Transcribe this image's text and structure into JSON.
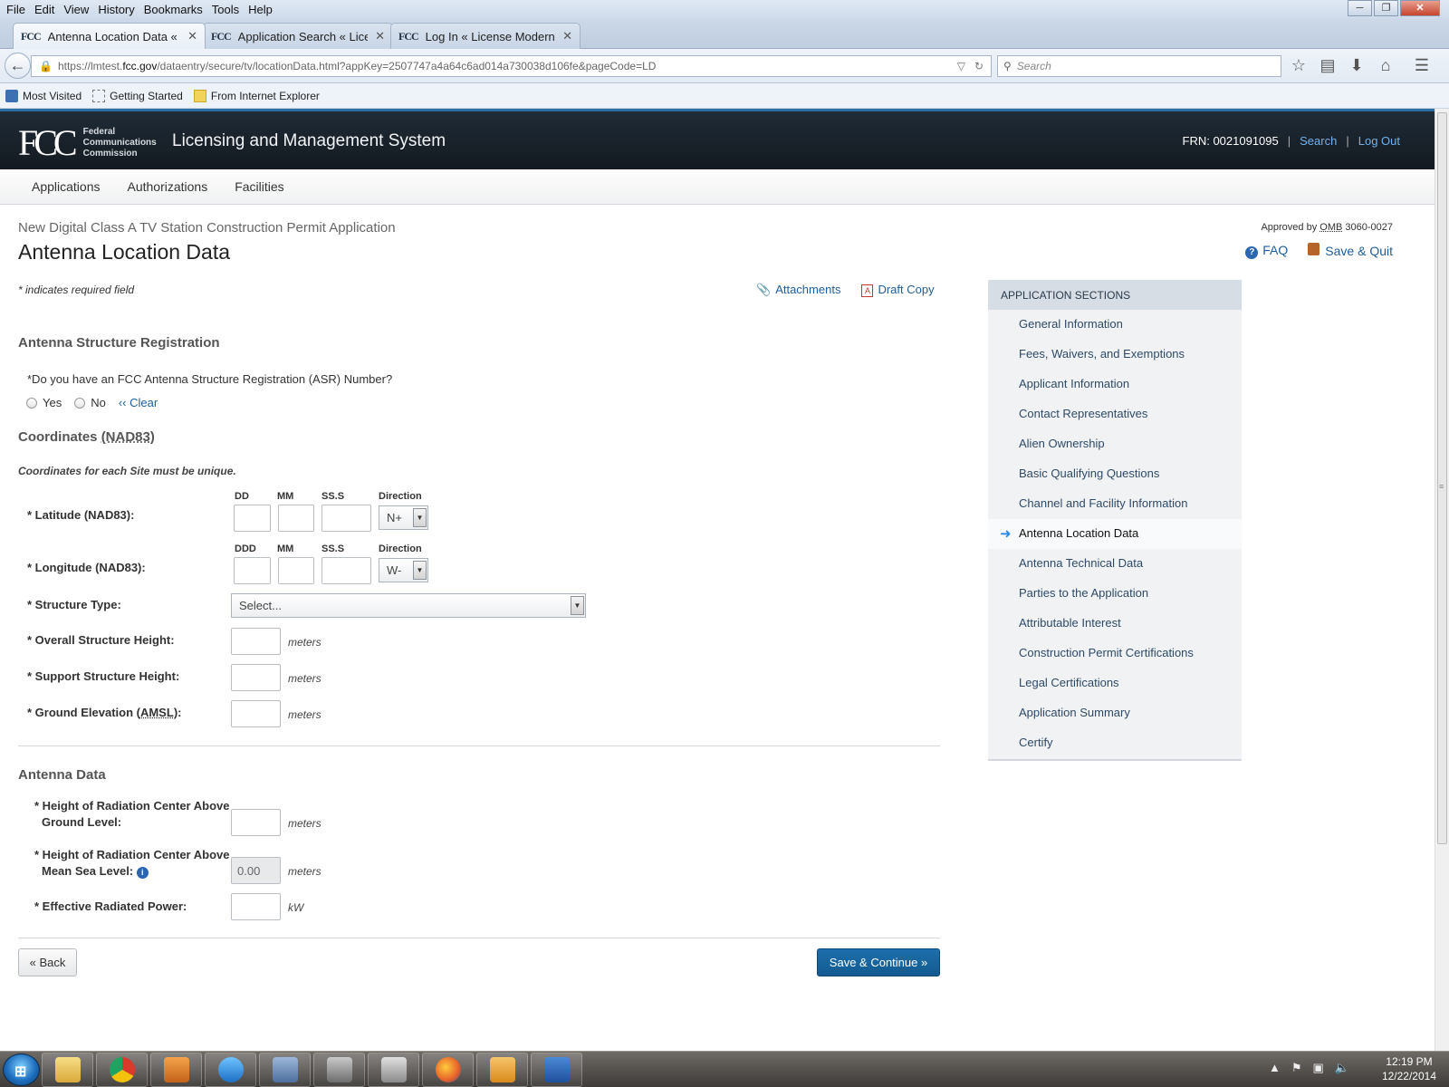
{
  "browser": {
    "menu": [
      "File",
      "Edit",
      "View",
      "History",
      "Bookmarks",
      "Tools",
      "Help"
    ],
    "tabs": [
      {
        "favicon": "FCC",
        "title": "Antenna Location Data « Li...",
        "active": true
      },
      {
        "favicon": "FCC",
        "title": "Application Search « Licen...",
        "active": false
      },
      {
        "favicon": "FCC",
        "title": "Log In « License Moderniza...",
        "active": false
      }
    ],
    "url_prefix": "https://lmtest.",
    "url_domain": "fcc.gov",
    "url_suffix": "/dataentry/secure/tv/locationData.html?appKey=2507747a4a64c6ad014a730038d106fe&pageCode=LD",
    "search_placeholder": "Search",
    "bookmarks": [
      "Most Visited",
      "Getting Started",
      "From Internet Explorer"
    ]
  },
  "header": {
    "org_line1": "Federal",
    "org_line2": "Communications",
    "org_line3": "Commission",
    "system_title": "Licensing and Management System",
    "frn": "FRN: 0021091095",
    "search_link": "Search",
    "logout_link": "Log Out"
  },
  "nav": [
    "Applications",
    "Authorizations",
    "Facilities"
  ],
  "page": {
    "breadcrumb": "New Digital Class A TV Station Construction Permit Application",
    "title": "Antenna Location Data",
    "approved": "Approved by",
    "omb": "OMB",
    "omb_number": "3060-0027",
    "faq": "FAQ",
    "save_quit": "Save & Quit",
    "required_note": "* indicates required field",
    "attachments": "Attachments",
    "draft_copy": "Draft Copy"
  },
  "asr": {
    "heading": "Antenna Structure Registration",
    "question": "*Do you have an FCC Antenna Structure Registration (ASR) Number?",
    "yes": "Yes",
    "no": "No",
    "clear": "‹‹ Clear"
  },
  "coords": {
    "heading": "Coordinates",
    "heading_abbr": "(NAD83)",
    "note": "Coordinates for each Site must be unique.",
    "lat_label": "* Latitude (NAD83):",
    "lon_label": "* Longitude (NAD83):",
    "lat_cols": [
      "DD",
      "MM",
      "SS.S",
      "Direction"
    ],
    "lon_cols": [
      "DDD",
      "MM",
      "SS.S",
      "Direction"
    ],
    "lat_dir": "N+",
    "lon_dir": "W-",
    "structure_type_label": "* Structure Type:",
    "structure_type_value": "Select...",
    "overall_height_label": "* Overall Structure Height:",
    "support_height_label": "* Support Structure Height:",
    "ground_elev_label_a": "* Ground Elevation (",
    "ground_elev_abbr": "AMSL",
    "ground_elev_label_b": "):",
    "unit_meters": "meters"
  },
  "antenna": {
    "heading": "Antenna Data",
    "rcagl_label_1": "* Height of Radiation Center Above",
    "rcagl_label_2": "Ground Level:",
    "rcamsl_label_1": "* Height of Radiation Center Above",
    "rcamsl_label_2": "Mean Sea Level:",
    "rcamsl_value": "0.00",
    "erp_label": "* Effective Radiated Power:",
    "unit_meters": "meters",
    "unit_kw": "kW"
  },
  "buttons": {
    "back": "« Back",
    "save_continue": "Save & Continue »"
  },
  "sidebar": {
    "heading": "APPLICATION SECTIONS",
    "items": [
      "General Information",
      "Fees, Waivers, and Exemptions",
      "Applicant Information",
      "Contact Representatives",
      "Alien Ownership",
      "Basic Qualifying Questions",
      "Channel and Facility Information",
      "Antenna Location Data",
      "Antenna Technical Data",
      "Parties to the Application",
      "Attributable Interest",
      "Construction Permit Certifications",
      "Legal Certifications",
      "Application Summary",
      "Certify"
    ],
    "current_index": 7
  },
  "taskbar": {
    "time": "12:19 PM",
    "date": "12/22/2014"
  },
  "colors": {
    "link": "#1f5e9c",
    "primary_button": "#1d6fad",
    "header_bg": "#1a232c"
  }
}
